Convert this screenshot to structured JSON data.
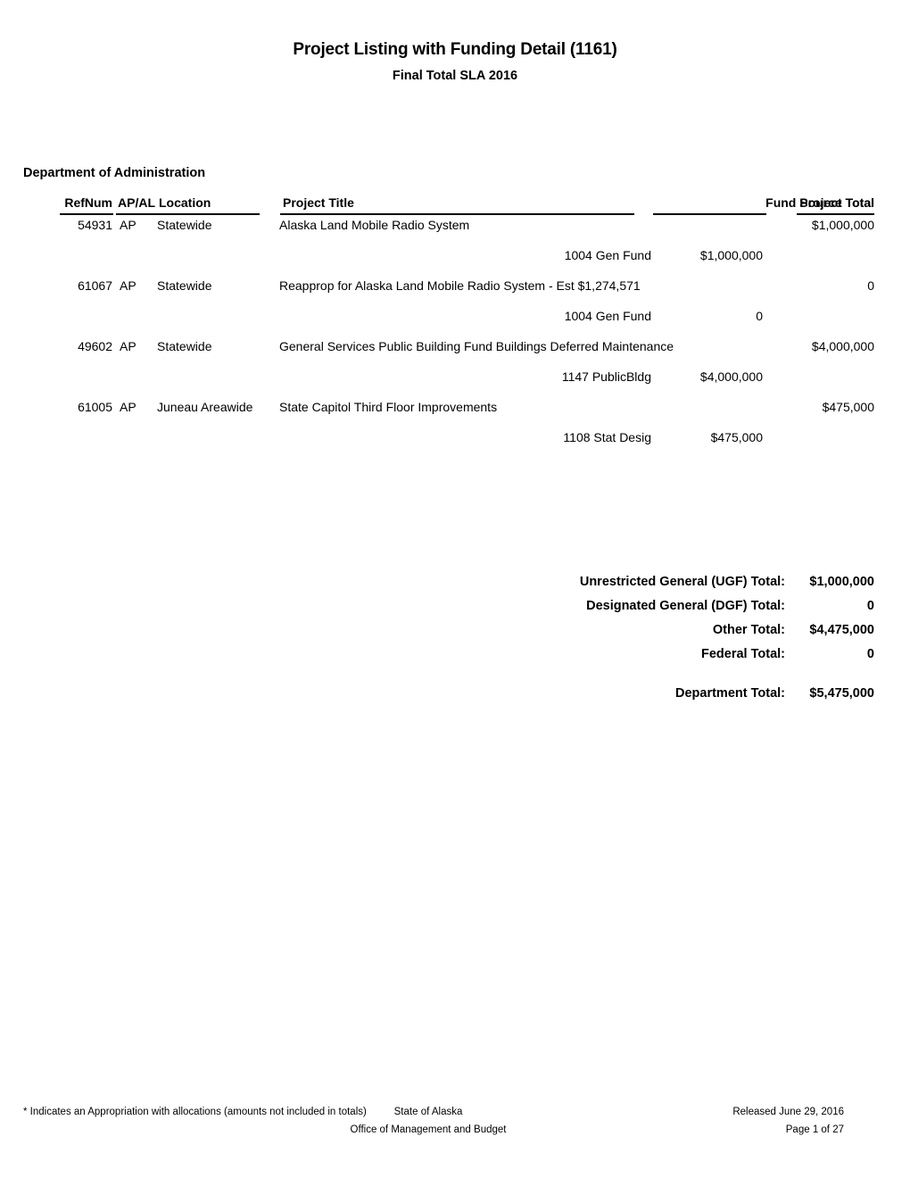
{
  "document": {
    "title": "Project Listing with Funding Detail (1161)",
    "subtitle": "Final Total SLA 2016"
  },
  "department": {
    "name": "Department of Administration"
  },
  "table": {
    "headers": {
      "refnum": "RefNum",
      "apal": "AP/AL",
      "location": "Location",
      "project_title": "Project Title",
      "fund_source_total": "Fund Source Total",
      "project_total": "Project Total"
    },
    "rows": [
      {
        "refnum": "54931",
        "apal": "AP",
        "location": "Statewide",
        "project_title": "Alaska Land Mobile Radio System",
        "project_total": "$1,000,000",
        "funds": [
          {
            "code": "1004 Gen Fund",
            "amount": "$1,000,000"
          }
        ]
      },
      {
        "refnum": "61067",
        "apal": "AP",
        "location": "Statewide",
        "project_title": "Reapprop for Alaska Land Mobile Radio System - Est $1,274,571",
        "project_total": "0",
        "funds": [
          {
            "code": "1004 Gen Fund",
            "amount": "0"
          }
        ]
      },
      {
        "refnum": "49602",
        "apal": "AP",
        "location": "Statewide",
        "project_title": "General Services Public Building Fund Buildings Deferred Maintenance",
        "project_total": "$4,000,000",
        "funds": [
          {
            "code": "1147 PublicBldg",
            "amount": "$4,000,000"
          }
        ]
      },
      {
        "refnum": "61005",
        "apal": "AP",
        "location": "Juneau Areawide",
        "project_title": "State Capitol Third Floor Improvements",
        "project_total": "$475,000",
        "funds": [
          {
            "code": "1108 Stat Desig",
            "amount": "$475,000"
          }
        ]
      }
    ]
  },
  "totals": {
    "lines": [
      {
        "label": "Unrestricted General (UGF) Total:",
        "value": "$1,000,000"
      },
      {
        "label": "Designated General (DGF) Total:",
        "value": "0"
      },
      {
        "label": "Other Total:",
        "value": "$4,475,000"
      },
      {
        "label": "Federal Total:",
        "value": "0"
      }
    ],
    "department_total": {
      "label": "Department Total:",
      "value": "$5,475,000"
    }
  },
  "footer": {
    "note": "* Indicates an Appropriation with allocations (amounts not included in totals)",
    "center_line1": "State of Alaska",
    "center_line2": "Office of Management and Budget",
    "right_line1": "Released June 29, 2016",
    "right_line2": "Page 1 of 27"
  }
}
